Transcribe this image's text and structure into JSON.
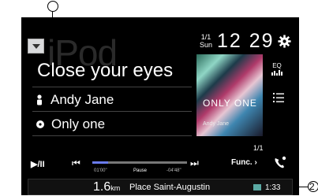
{
  "callouts": {
    "top": "1",
    "right": "2"
  },
  "background": {
    "source_name": "iPod"
  },
  "track": {
    "title": "Close your eyes",
    "artist": "Andy Jane",
    "album": "Only one"
  },
  "clock": {
    "date_top": "1/1",
    "date_bottom": "Sun",
    "time": "12 29"
  },
  "side": {
    "eq_label": "EQ"
  },
  "album_art": {
    "text": "ONLY ONE",
    "sub": "Andy Jane"
  },
  "playback": {
    "track_count": "1/1",
    "elapsed": "01'00\"",
    "status": "Pause",
    "remaining": "-04'48\"",
    "progress_fraction": 0.17
  },
  "controls": {
    "func_label": "Func."
  },
  "navigation": {
    "distance_value": "1.6",
    "distance_unit": "km",
    "place": "Place Saint-Augustin",
    "eta": "1:33"
  },
  "colors": {
    "screen_bg": "#000000",
    "progress": "#6a7cf0",
    "text": "#ffffff"
  }
}
